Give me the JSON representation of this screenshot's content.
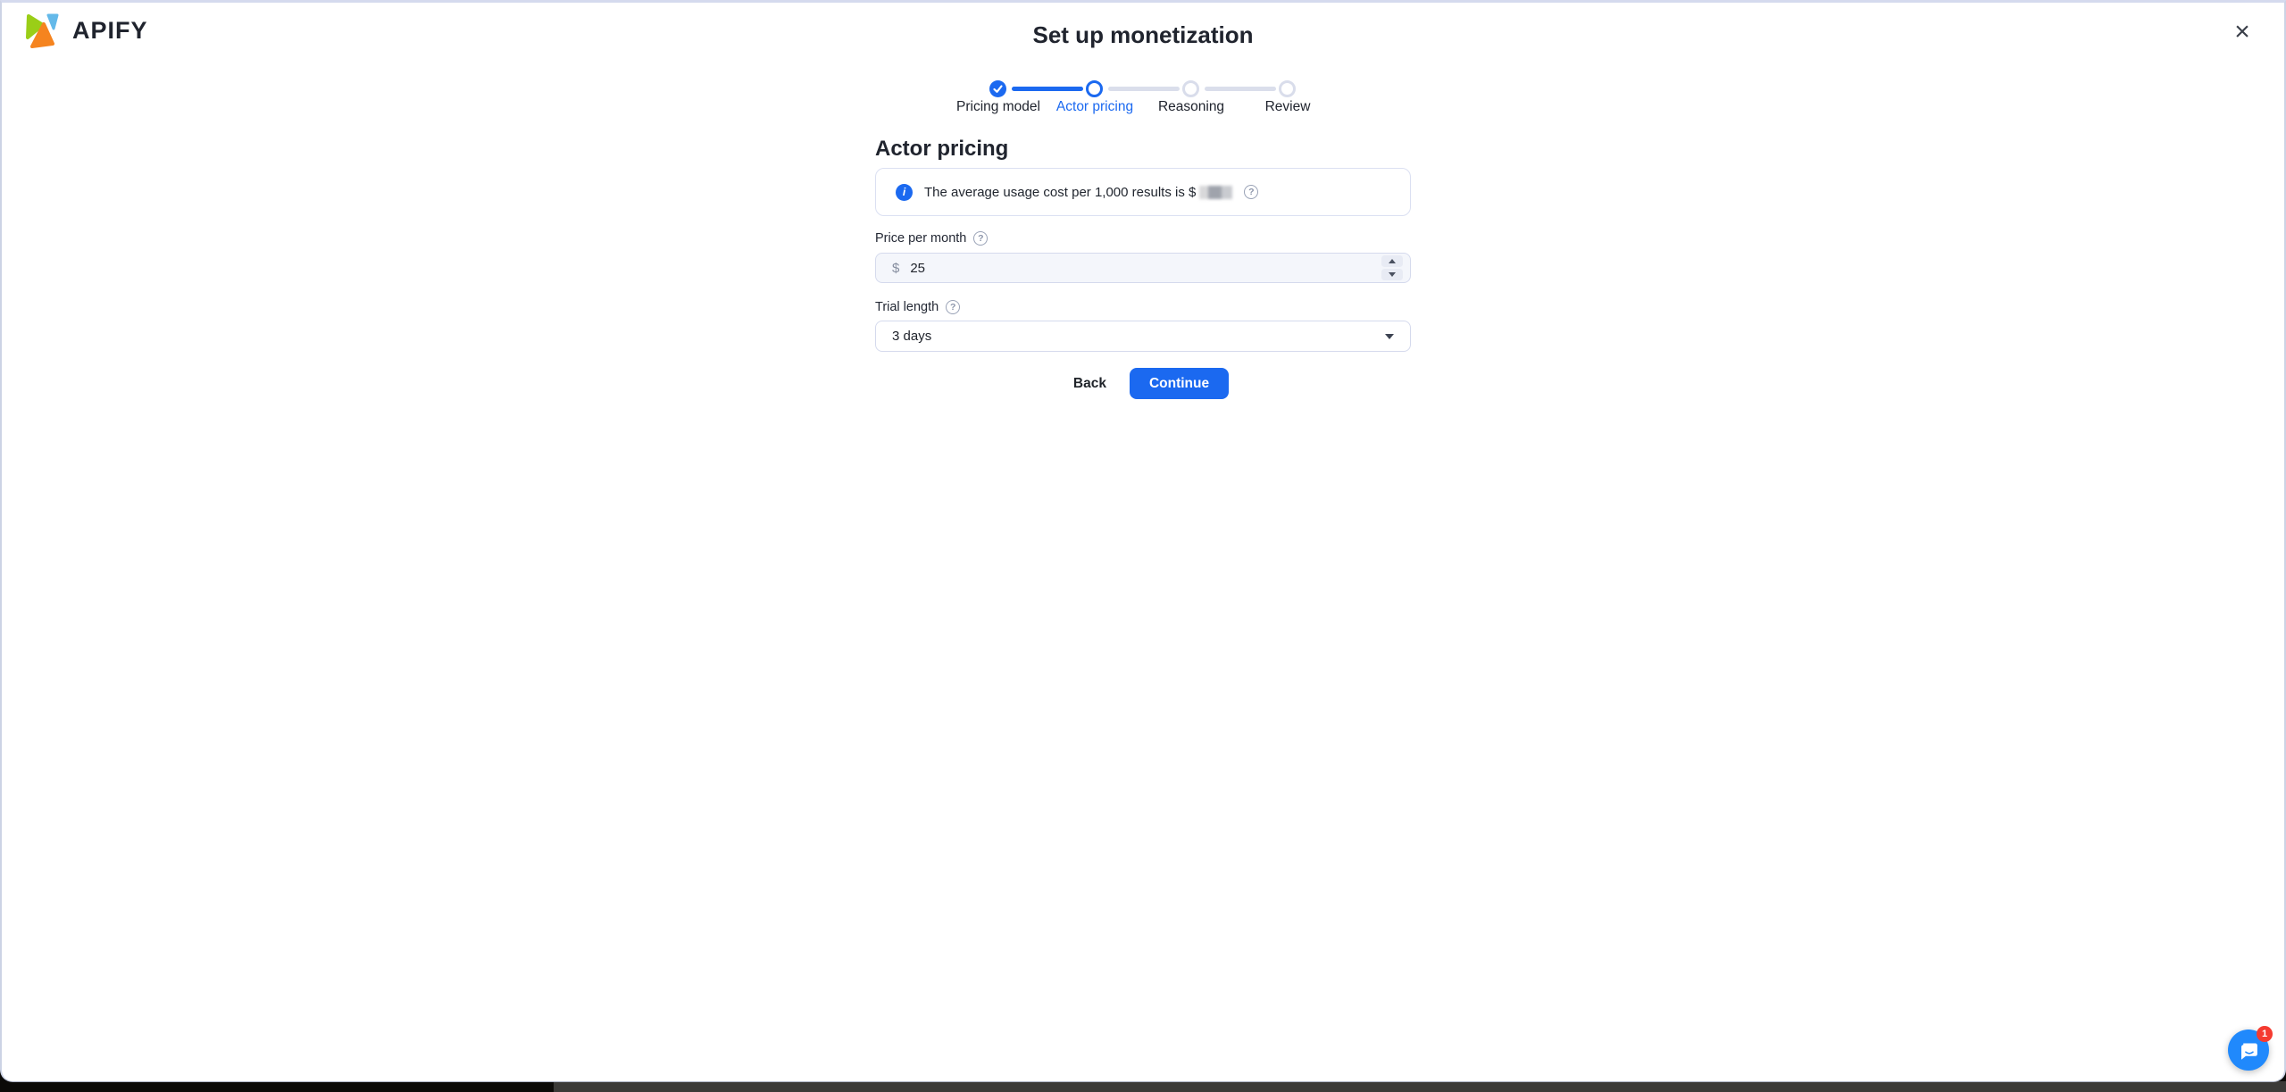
{
  "brand": {
    "name": "APIFY"
  },
  "header": {
    "title": "Set up monetization"
  },
  "icons": {
    "close": "×"
  },
  "stepper": {
    "steps": [
      {
        "label": "Pricing model",
        "state": "completed"
      },
      {
        "label": "Actor pricing",
        "state": "active"
      },
      {
        "label": "Reasoning",
        "state": "upcoming"
      },
      {
        "label": "Review",
        "state": "upcoming"
      }
    ]
  },
  "form": {
    "heading": "Actor pricing",
    "info_banner": {
      "text_before_value": "The average usage cost per 1,000 results is $",
      "value_redacted": true
    },
    "price_field": {
      "label": "Price per month",
      "currency_symbol": "$",
      "value": "25"
    },
    "trial_field": {
      "label": "Trial length",
      "selected_option": "3 days"
    },
    "back_label": "Back",
    "continue_label": "Continue"
  },
  "chat": {
    "badge_count": "1"
  },
  "colors": {
    "primary_blue": "#1b69f0",
    "text_dark": "#20242e",
    "border_light": "#d5daed",
    "intercom_blue": "#2089fc",
    "badge_red": "#f53b30",
    "logo_green": "#9ace17",
    "logo_orange": "#f5841f",
    "logo_blue": "#64b9e9"
  }
}
